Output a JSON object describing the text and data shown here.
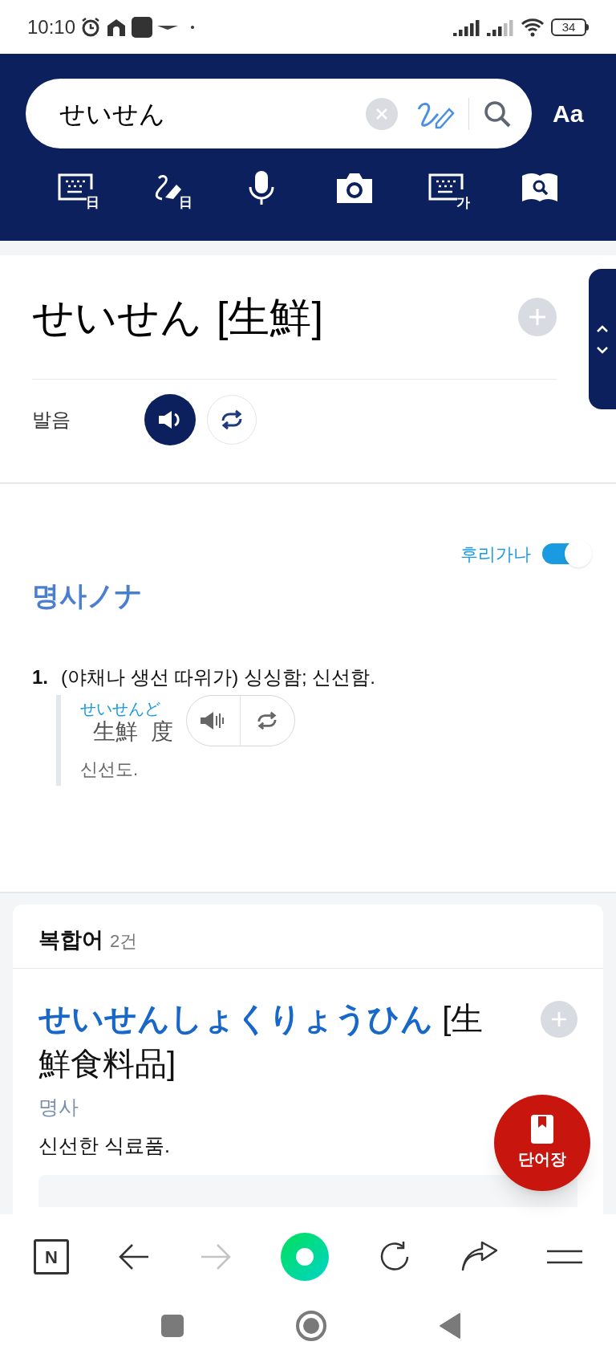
{
  "status_bar": {
    "time": "10:10",
    "battery": "34"
  },
  "search": {
    "value": "せいせん"
  },
  "font_button": "Aa",
  "input_tools": [
    {
      "kind": "keyboard",
      "badge": "日"
    },
    {
      "kind": "handwriting",
      "badge": "日"
    },
    {
      "kind": "voice"
    },
    {
      "kind": "camera"
    },
    {
      "kind": "keyboard",
      "badge": "가"
    },
    {
      "kind": "book-search"
    }
  ],
  "entry": {
    "headword": "せいせん",
    "hanja": "[生鮮]",
    "pron_label": "발음"
  },
  "furigana": {
    "label": "후리가나",
    "on": true
  },
  "pos": "명사ノナ",
  "senses": [
    {
      "number": "1.",
      "text": "(야채나 생선 따위가) 싱싱함; 신선함.",
      "examples": [
        {
          "furigana": "せいせんど",
          "text": "生鮮  度",
          "translation": "신선도."
        }
      ]
    }
  ],
  "compounds": {
    "title": "복합어",
    "count": "2건",
    "items": [
      {
        "reading": "せいせんしょくりょうひん",
        "hanja": "[生鮮食料品]",
        "pos": "명사",
        "meaning": "신선한 식료품."
      }
    ]
  },
  "fab": "단어장",
  "toolbar": {
    "logo": "N",
    "forward_disabled": true
  }
}
